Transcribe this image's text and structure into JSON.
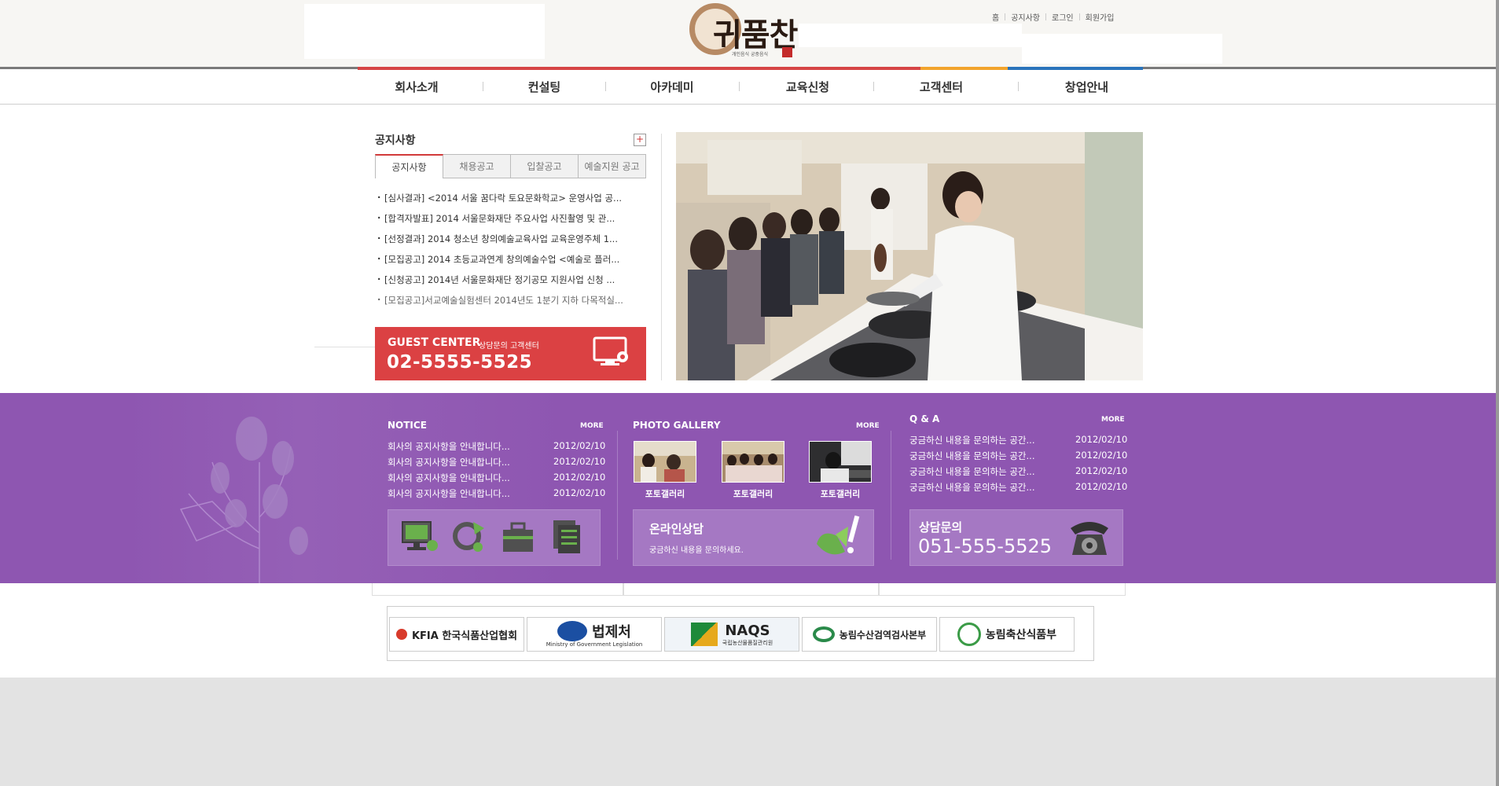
{
  "header": {
    "logo_text": "귀품찬",
    "logo_tagline": "개인음식 궁중음식",
    "util_links": [
      "홈",
      "공지사항",
      "로그인",
      "회원가입"
    ]
  },
  "gnav": {
    "items": [
      {
        "label": "회사소개",
        "color": "#d64545"
      },
      {
        "label": "컨설팅",
        "color": "#d64545"
      },
      {
        "label": "아카데미",
        "color": "#d64545"
      },
      {
        "label": "교육신청",
        "color": "#d64545"
      },
      {
        "label": "고객센터",
        "color": "#f2a42c"
      },
      {
        "label": "창업안내",
        "color": "#2a74bb"
      }
    ]
  },
  "notice_panel": {
    "title": "공지사항",
    "plus": "+",
    "tabs": [
      "공지사항",
      "채용공고",
      "입찰공고",
      "예술지원 공고"
    ],
    "items": [
      "[심사결과] <2014 서울 꿈다락 토요문화학교> 운영사업 공...",
      "[합격자발표] 2014 서울문화재단 주요사업 사진촬영 및 관...",
      "[선정결과] 2014 청소년 창의예술교육사업 교육운영주체 1...",
      "[모집공고] 2014 초등교과연계 창의예술수업 <예술로 플러...",
      "[신청공고] 2014년 서울문화재단 정기공모 지원사업 신청 ...",
      "[모집공고]서교예술실험센터 2014년도 1분기 지하 다목적실..."
    ]
  },
  "guest_center": {
    "label": "GUEST CENTER",
    "sub": "상담문의 고객센터",
    "phone": "02-5555-5525"
  },
  "notice_block": {
    "title": "NOTICE",
    "more": "MORE",
    "rows": [
      {
        "text": "회사의 공지사항을 안내합니다...",
        "date": "2012/02/10"
      },
      {
        "text": "회사의 공지사항을 안내합니다...",
        "date": "2012/02/10"
      },
      {
        "text": "회사의 공지사항을 안내합니다...",
        "date": "2012/02/10"
      },
      {
        "text": "회사의 공지사항을 안내합니다...",
        "date": "2012/02/10"
      }
    ]
  },
  "gallery_block": {
    "title": "PHOTO GALLERY",
    "more": "MORE",
    "thumbs": [
      "포토갤러리",
      "포토갤러리",
      "포토갤러리"
    ]
  },
  "qa_block": {
    "title": "Q & A",
    "more": "MORE",
    "rows": [
      {
        "text": "궁금하신 내용을 문의하는 공간...",
        "date": "2012/02/10"
      },
      {
        "text": "궁금하신 내용을 문의하는 공간...",
        "date": "2012/02/10"
      },
      {
        "text": "궁금하신 내용을 문의하는 공간...",
        "date": "2012/02/10"
      },
      {
        "text": "궁금하신 내용을 문의하는 공간...",
        "date": "2012/02/10"
      }
    ]
  },
  "online_consult": {
    "title": "온라인상담",
    "sub": "궁금하신 내용을 문의하세요."
  },
  "phone_consult": {
    "title": "상담문의",
    "phone": "051-555-5525"
  },
  "partners": [
    {
      "label": "KFIA 한국식품산업협회"
    },
    {
      "label": "법제처",
      "sub": "Ministry of Government Legislation"
    },
    {
      "label": "NAQS",
      "sub": "국립농산물품질관리원"
    },
    {
      "label": "농림수산검역검사본부"
    },
    {
      "label": "농림축산식품부"
    }
  ],
  "colors": {
    "purple": "#8e56b1",
    "red": "#db4143",
    "orange": "#f2a42c",
    "blue": "#2a74bb"
  }
}
